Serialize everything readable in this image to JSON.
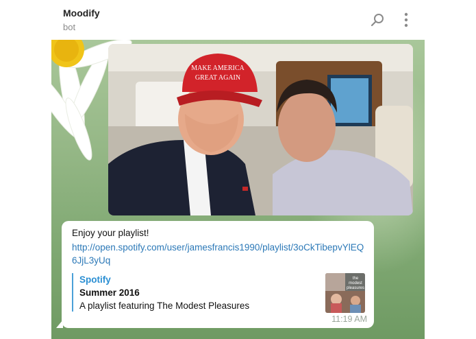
{
  "header": {
    "title": "Moodify",
    "subtitle": "bot",
    "search_icon": "search-icon",
    "menu_icon": "more-vertical-icon"
  },
  "photo": {
    "cap_text_line1": "MAKE AMERICA",
    "cap_text_line2": "GREAT AGAIN"
  },
  "message": {
    "text": "Enjoy your playlist!",
    "link": "http://open.spotify.com/user/jamesfrancis1990/playlist/3oCkTibepvYlEQ6JjL3yUq",
    "preview": {
      "site": "Spotify",
      "title": "Summer 2016",
      "description": "A playlist featuring The Modest Pleasures",
      "thumb_text_line1": "the",
      "thumb_text_line2": "modest",
      "thumb_text_line3": "pleasures"
    },
    "time": "11:19 AM"
  },
  "colors": {
    "link": "#2b78b7",
    "site": "#2b8fd3",
    "cap_red": "#d2232a",
    "chat_bg": "#96b887"
  }
}
